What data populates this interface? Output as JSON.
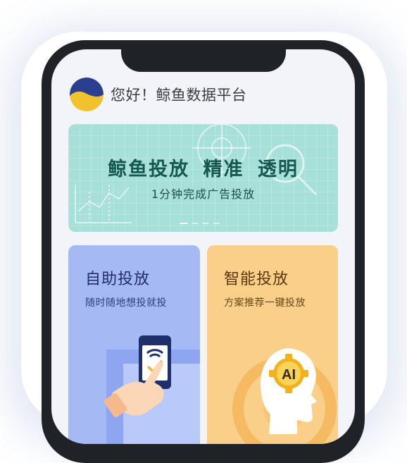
{
  "header": {
    "greeting": "您好！鲸鱼数据平台",
    "logo_icon": "whale-logo-icon"
  },
  "banner": {
    "title": "鲸鱼投放  精准  透明",
    "subtitle": "1分钟完成广告投放",
    "slides": 4,
    "active_slide": 0
  },
  "cards": [
    {
      "title": "自助投放",
      "subtitle": "随时随地想投就投",
      "icon": "phone-tap-icon"
    },
    {
      "title": "智能投放",
      "subtitle": "方案推荐一键投放",
      "icon": "ai-head-icon"
    }
  ],
  "colors": {
    "banner_bg": "#a7e0d9",
    "banner_text": "#15584f",
    "card_left_bg": "#a5b9f5",
    "card_right_bg": "#f9cf8a",
    "logo_blue": "#2a3f8f",
    "logo_yellow": "#f2c12e"
  }
}
